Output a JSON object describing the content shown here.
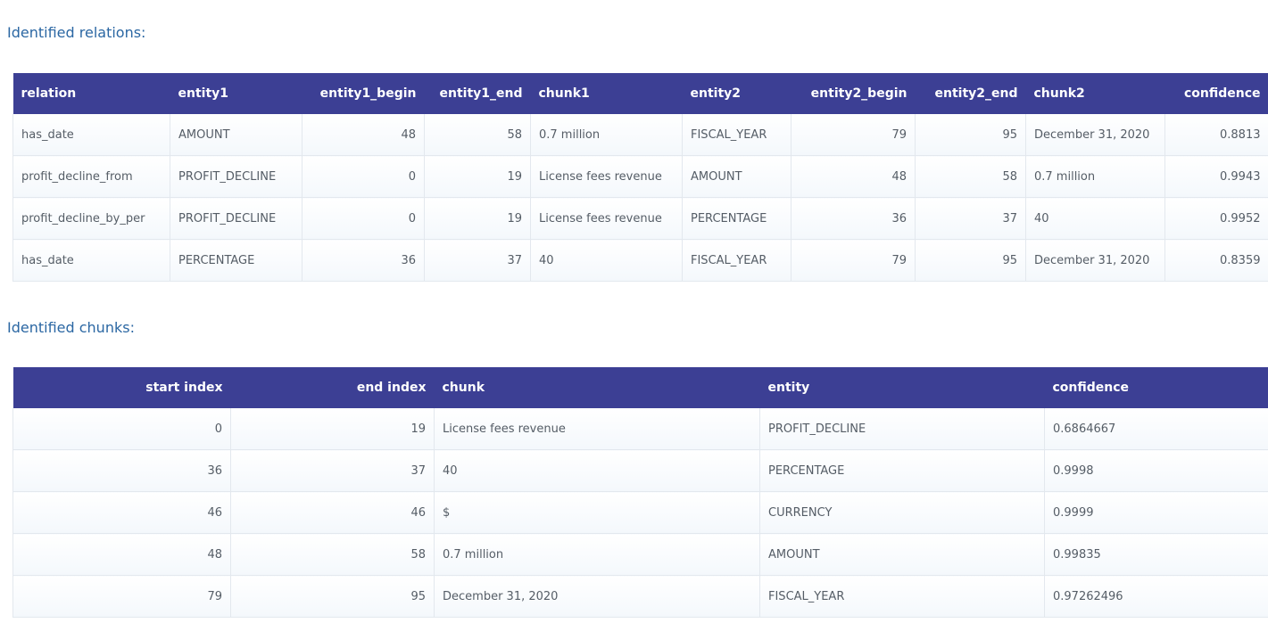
{
  "relations_section": {
    "title": "Identified relations:",
    "columns": [
      "relation",
      "entity1",
      "entity1_begin",
      "entity1_end",
      "chunk1",
      "entity2",
      "entity2_begin",
      "entity2_end",
      "chunk2",
      "confidence"
    ],
    "rows": [
      [
        "has_date",
        "AMOUNT",
        "48",
        "58",
        "0.7 million",
        "FISCAL_YEAR",
        "79",
        "95",
        "December 31, 2020",
        "0.8813"
      ],
      [
        "profit_decline_from",
        "PROFIT_DECLINE",
        "0",
        "19",
        "License fees revenue",
        "AMOUNT",
        "48",
        "58",
        "0.7 million",
        "0.9943"
      ],
      [
        "profit_decline_by_per",
        "PROFIT_DECLINE",
        "0",
        "19",
        "License fees revenue",
        "PERCENTAGE",
        "36",
        "37",
        "40",
        "0.9952"
      ],
      [
        "has_date",
        "PERCENTAGE",
        "36",
        "37",
        "40",
        "FISCAL_YEAR",
        "79",
        "95",
        "December 31, 2020",
        "0.8359"
      ]
    ]
  },
  "chunks_section": {
    "title": "Identified chunks:",
    "columns": [
      "start index",
      "end index",
      "chunk",
      "entity",
      "confidence"
    ],
    "rows": [
      [
        "0",
        "19",
        "License fees revenue",
        "PROFIT_DECLINE",
        "0.6864667"
      ],
      [
        "36",
        "37",
        "40",
        "PERCENTAGE",
        "0.9998"
      ],
      [
        "46",
        "46",
        "$",
        "CURRENCY",
        "0.9999"
      ],
      [
        "48",
        "58",
        "0.7 million",
        "AMOUNT",
        "0.99835"
      ],
      [
        "79",
        "95",
        "December 31, 2020",
        "FISCAL_YEAR",
        "0.97262496"
      ]
    ]
  },
  "colors": {
    "header_bg": "#3c3f94",
    "title_text": "#2b67a3",
    "cell_text": "#555d66"
  }
}
